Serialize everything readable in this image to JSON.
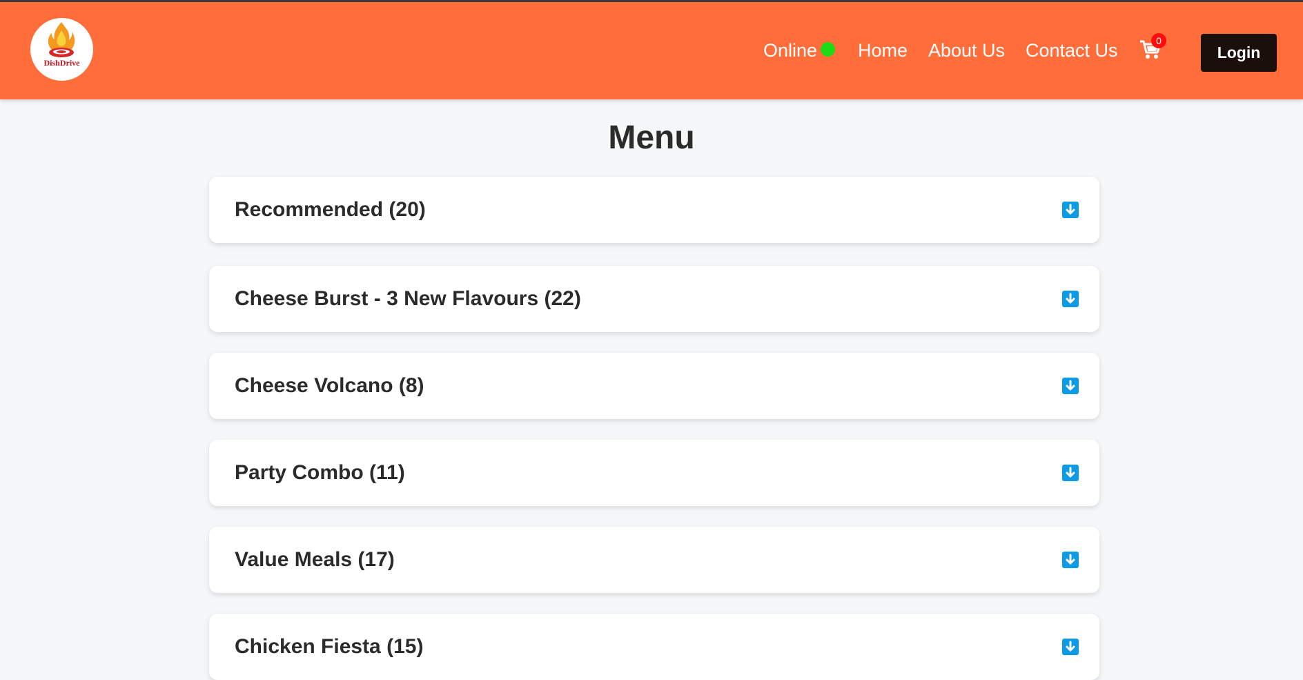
{
  "header": {
    "logo_text": "DishDrive",
    "nav": {
      "online_label": "Online",
      "home_label": "Home",
      "about_label": "About Us",
      "contact_label": "Contact Us",
      "cart_count": "0",
      "login_label": "Login"
    },
    "colors": {
      "header_bg": "#ff6d3a",
      "online_dot": "#1edb16",
      "login_bg": "#1b0f0c",
      "cart_badge": "#ff0d0d",
      "accordion_icon": "#0e9be6"
    },
    "icons": [
      "cart-icon",
      "online-status-dot"
    ]
  },
  "main": {
    "title": "Menu",
    "categories": [
      {
        "label": "Recommended (20)",
        "icon": "arrow-down-icon"
      },
      {
        "label": "Cheese Burst - 3 New Flavours (22)",
        "icon": "arrow-down-icon"
      },
      {
        "label": "Cheese Volcano (8)",
        "icon": "arrow-down-icon"
      },
      {
        "label": "Party Combo (11)",
        "icon": "arrow-down-icon"
      },
      {
        "label": "Value Meals (17)",
        "icon": "arrow-down-icon"
      },
      {
        "label": "Chicken Fiesta (15)",
        "icon": "arrow-down-icon"
      }
    ]
  }
}
